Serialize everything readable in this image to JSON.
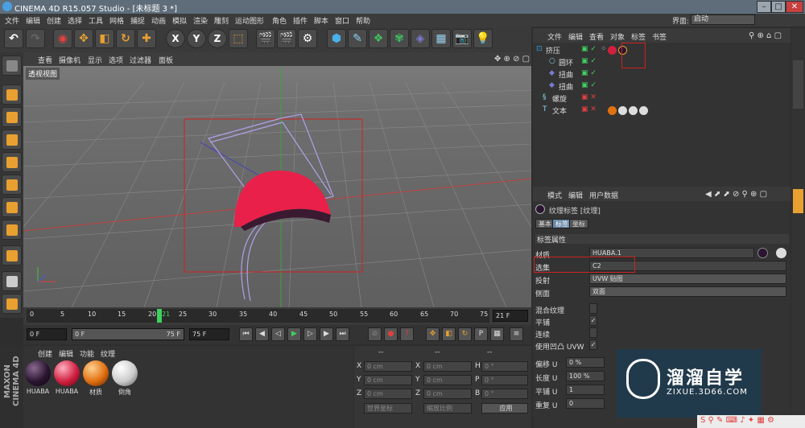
{
  "window": {
    "title": "CINEMA 4D R15.057 Studio - [未标题 3 *]"
  },
  "menubar": {
    "items": [
      "文件",
      "编辑",
      "创建",
      "选择",
      "工具",
      "网格",
      "捕捉",
      "动画",
      "模拟",
      "渲染",
      "雕刻",
      "运动图形",
      "角色",
      "插件",
      "脚本",
      "窗口",
      "帮助"
    ],
    "layout_label": "界面:",
    "layout_value": "启动"
  },
  "viewport": {
    "menu": [
      "查看",
      "摄像机",
      "显示",
      "选项",
      "过滤器",
      "面板"
    ],
    "label": "透视视图"
  },
  "timeline": {
    "ticks": [
      "0",
      "5",
      "10",
      "15",
      "20",
      "21",
      "25",
      "30",
      "35",
      "40",
      "45",
      "50",
      "55",
      "60",
      "65",
      "70",
      "75"
    ],
    "current_frame": "21 F",
    "current": 21
  },
  "playbar": {
    "start": "0 F",
    "range_start": "0 F",
    "range_end": "75 F",
    "end": "75 F"
  },
  "materials": {
    "menu": [
      "创建",
      "编辑",
      "功能",
      "纹理"
    ],
    "items": [
      {
        "name": "HUABA",
        "color": "#2a1530"
      },
      {
        "name": "HUABA",
        "color": "#d02040"
      },
      {
        "name": "材质",
        "color": "#e07010"
      },
      {
        "name": "倒角",
        "color": "#cccccc"
      }
    ]
  },
  "coords": {
    "headers": [
      "--",
      "--",
      "--"
    ],
    "rows": [
      {
        "axis": "X",
        "pos": "0 cm",
        "size": "0 cm",
        "rlabel": "H",
        "rot": "0 °"
      },
      {
        "axis": "Y",
        "pos": "0 cm",
        "size": "0 cm",
        "rlabel": "P",
        "rot": "0 °"
      },
      {
        "axis": "Z",
        "pos": "0 cm",
        "size": "0 cm",
        "rlabel": "B",
        "rot": "0 °"
      }
    ],
    "mode1": "世界坐标",
    "mode2": "缩放比例",
    "apply": "应用"
  },
  "objects": {
    "menu": [
      "文件",
      "编辑",
      "查看",
      "对象",
      "标签",
      "书签"
    ],
    "rows": [
      {
        "name": "挤压",
        "indent": 0
      },
      {
        "name": "圆环",
        "indent": 1
      },
      {
        "name": "扭曲",
        "indent": 1
      },
      {
        "name": "扭曲",
        "indent": 1
      },
      {
        "name": "螺旋",
        "indent": 0
      },
      {
        "name": "文本",
        "indent": 0
      }
    ]
  },
  "attributes": {
    "menu": [
      "模式",
      "编辑",
      "用户数据"
    ],
    "header": "纹理标签 [纹理]",
    "tabs": [
      "基本",
      "标签",
      "坐标"
    ],
    "section": "标签属性",
    "material_label": "材质",
    "material_value": "HUABA.1",
    "selection_label": "选集",
    "selection_value": "C2",
    "projection_label": "投射",
    "projection_value": "UVW 贴图",
    "side_label": "侧面",
    "side_value": "双面",
    "checks": [
      {
        "label": "混合纹理",
        "checked": ""
      },
      {
        "label": "平铺",
        "checked": "✓"
      },
      {
        "label": "连续",
        "checked": ""
      },
      {
        "label": "使用凹凸 UVW",
        "checked": "✓"
      }
    ],
    "offset_u_label": "偏移 U",
    "offset_u": "0 %",
    "length_u_label": "长度 U",
    "length_u": "100 %",
    "tile_u_label": "平铺 U",
    "tile_u": "1",
    "repeat_u_label": "重复 U",
    "repeat_u": "0"
  },
  "watermark": {
    "title": "溜溜自学",
    "sub": "ZIXUE.3D66.COM"
  },
  "colors": {
    "cap": "#e8204a",
    "accent": "#e8a030"
  }
}
